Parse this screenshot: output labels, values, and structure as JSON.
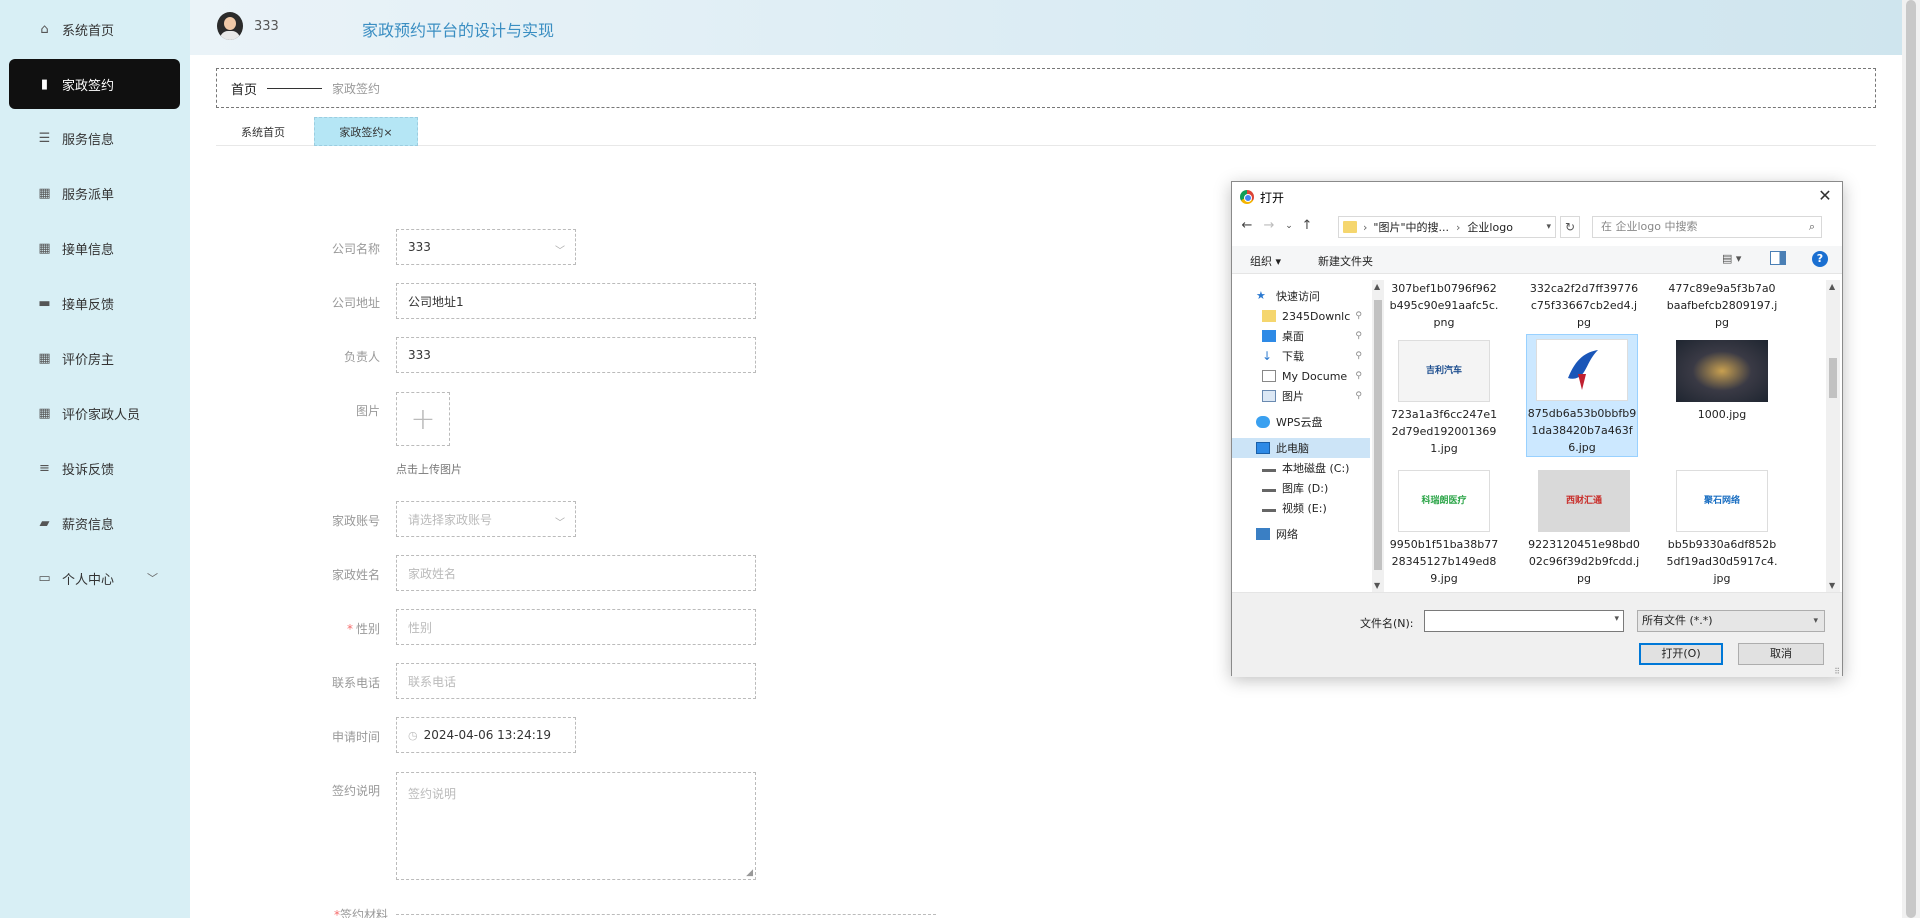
{
  "sidebar": {
    "items": [
      {
        "label": "系统首页",
        "icon": "home-icon"
      },
      {
        "label": "家政签约",
        "icon": "bar-chart-icon"
      },
      {
        "label": "服务信息",
        "icon": "list-icon"
      },
      {
        "label": "服务派单",
        "icon": "grid-icon"
      },
      {
        "label": "接单信息",
        "icon": "grid-icon"
      },
      {
        "label": "接单反馈",
        "icon": "monitor-icon"
      },
      {
        "label": "评价房主",
        "icon": "grid-icon"
      },
      {
        "label": "评价家政人员",
        "icon": "grid-icon"
      },
      {
        "label": "投诉反馈",
        "icon": "sliders-icon"
      },
      {
        "label": "薪资信息",
        "icon": "wallet-icon"
      },
      {
        "label": "个人中心",
        "icon": "card-icon"
      }
    ]
  },
  "header": {
    "user_name": "333",
    "app_title": "家政预约平台的设计与实现"
  },
  "breadcrumb": {
    "home": "首页",
    "current": "家政签约"
  },
  "tabs": [
    {
      "label": "系统首页"
    },
    {
      "label": "家政签约×"
    }
  ],
  "form": {
    "company_name": {
      "label": "公司名称",
      "value": "333"
    },
    "company_address": {
      "label": "公司地址",
      "value": "公司地址1"
    },
    "manager": {
      "label": "负责人",
      "value": "333"
    },
    "image": {
      "label": "图片",
      "plus": "+",
      "hint": "点击上传图片"
    },
    "account": {
      "label": "家政账号",
      "placeholder": "请选择家政账号"
    },
    "name": {
      "label": "家政姓名",
      "placeholder": "家政姓名"
    },
    "gender": {
      "label": "性别",
      "required_mark": "*",
      "placeholder": "性别"
    },
    "phone": {
      "label": "联系电话",
      "placeholder": "联系电话"
    },
    "apply_time": {
      "label": "申请时间",
      "value": "2024-04-06 13:24:19"
    },
    "remark": {
      "label": "签约说明",
      "placeholder": "签约说明"
    },
    "material": {
      "label": "签约材料",
      "required_mark": "*"
    }
  },
  "dialog": {
    "title": "打开",
    "close": "✕",
    "path": [
      "\"图片\"中的搜...",
      "企业logo"
    ],
    "search_placeholder": "在 企业logo 中搜索",
    "toolbar": {
      "organize": "组织 ▾",
      "new_folder": "新建文件夹",
      "help": "?"
    },
    "tree": [
      {
        "label": "快速访问",
        "icon": "star-icon"
      },
      {
        "label": "2345Downlc",
        "icon": "folder-icon",
        "pinned": true
      },
      {
        "label": "桌面",
        "icon": "desktop-icon",
        "pinned": true
      },
      {
        "label": "下载",
        "icon": "download-icon",
        "pinned": true
      },
      {
        "label": "My Docume",
        "icon": "document-icon",
        "pinned": true
      },
      {
        "label": "图片",
        "icon": "picture-icon",
        "pinned": true
      },
      {
        "label": "WPS云盘",
        "icon": "cloud-icon"
      },
      {
        "label": "此电脑",
        "icon": "computer-icon",
        "selected": true
      },
      {
        "label": "本地磁盘 (C:)",
        "icon": "drive-icon"
      },
      {
        "label": "图库 (D:)",
        "icon": "drive-icon"
      },
      {
        "label": "视频 (E:)",
        "icon": "drive-icon"
      },
      {
        "label": "网络",
        "icon": "network-icon"
      }
    ],
    "files": [
      {
        "name": "307bef1b0796f962b495c90e91aafc5c.png",
        "thumb": ""
      },
      {
        "name": "332ca2f2d7ff39776c75f33667cb2ed4.jpg",
        "thumb": ""
      },
      {
        "name": "477c89e9a5f3b7a0baafbefcb2809197.jpg",
        "thumb": ""
      },
      {
        "name": "723a1a3f6cc247e12d79ed1920013691.jpg",
        "thumb": "吉利汽车",
        "thumb_color": "#1d4e8f"
      },
      {
        "name": "875db6a53b0bbfb91da38420b7a463f6.jpg",
        "thumb": "",
        "thumb_color": "#1a56b8",
        "selected": true
      },
      {
        "name": "1000.jpg",
        "thumb": "",
        "thumb_color": "#2a2f3a"
      },
      {
        "name": "9950b1f51ba38b7728345127b149ed89.jpg",
        "thumb": "科瑞朗医疗",
        "thumb_color": "#2ea64a"
      },
      {
        "name": "9223120451e98bd002c96f39d2b9fcdd.jpg",
        "thumb": "西财汇通",
        "thumb_color": "#c9302c"
      },
      {
        "name": "bb5b9330a6df852b5df19ad30d5917c4.jpg",
        "thumb": "聚石网络",
        "thumb_color": "#1b6fc2"
      }
    ],
    "filename_label": "文件名(N):",
    "filetype": "所有文件 (*.*)",
    "open_label": "打开(O)",
    "cancel_label": "取消"
  }
}
